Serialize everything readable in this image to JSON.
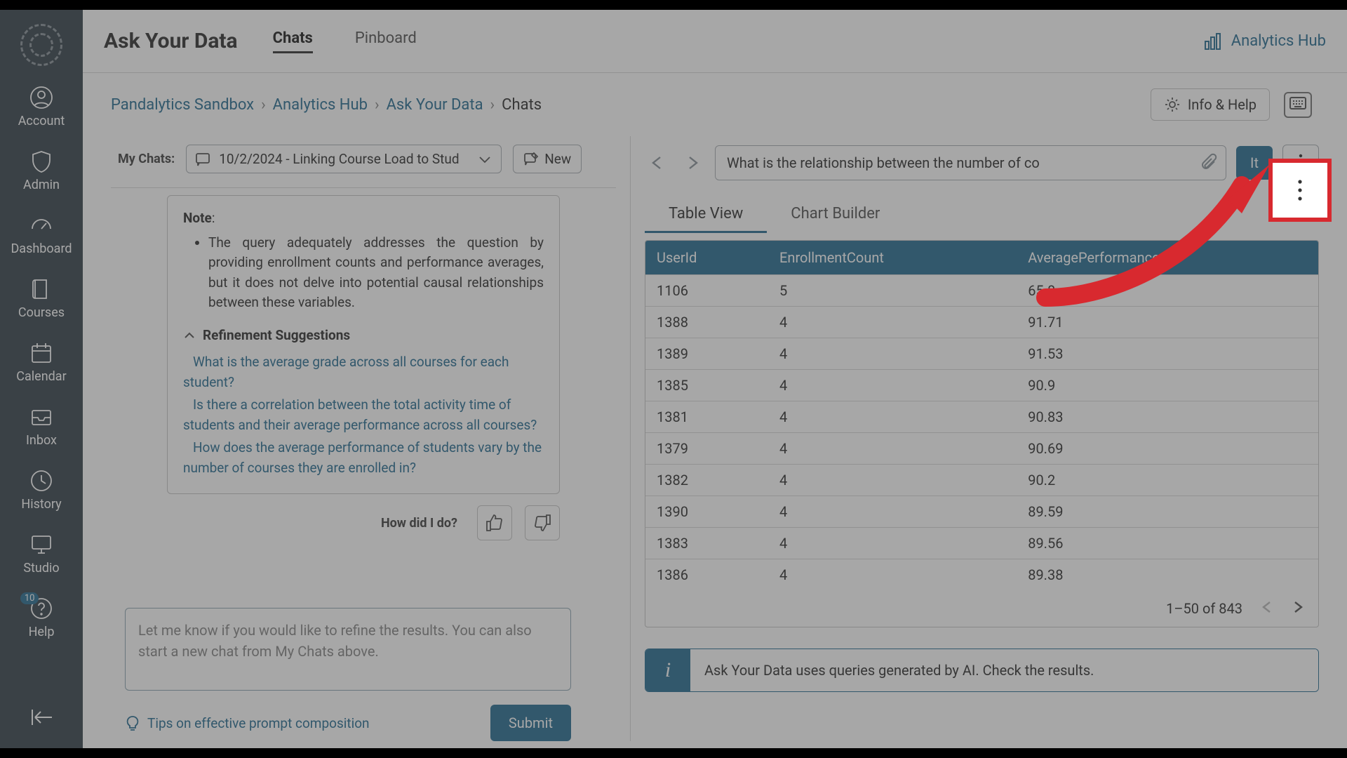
{
  "sidebar": {
    "items": [
      {
        "label": "Account"
      },
      {
        "label": "Admin"
      },
      {
        "label": "Dashboard"
      },
      {
        "label": "Courses"
      },
      {
        "label": "Calendar"
      },
      {
        "label": "Inbox"
      },
      {
        "label": "History"
      },
      {
        "label": "Studio"
      },
      {
        "label": "Help",
        "badge": "10"
      }
    ]
  },
  "header": {
    "app_title": "Ask Your Data",
    "tabs": [
      {
        "label": "Chats"
      },
      {
        "label": "Pinboard"
      }
    ],
    "hub_link": "Analytics Hub"
  },
  "breadcrumb": {
    "items": [
      "Pandalytics Sandbox",
      "Analytics Hub",
      "Ask Your Data",
      "Chats"
    ],
    "info_help": "Info & Help"
  },
  "left": {
    "mychats_label": "My Chats:",
    "selected_chat": "10/2/2024 - Linking Course Load to Stud",
    "new_btn": "New",
    "note_label": "Note",
    "note_bullet": "The query adequately addresses the question by providing enrollment counts and performance averages, but it does not delve into potential causal relationships between these variables.",
    "refine_header": "Refinement Suggestions",
    "suggestions": [
      "What is the average grade across all courses for each student?",
      "Is there a correlation between the total activity time of students and their average performance across all courses?",
      "How does the average performance of students vary by the number of courses they are enrolled in?"
    ],
    "feedback_q": "How did I do?",
    "refine_placeholder": "Let me know if you would like to refine the results.  You can also start a new chat from My Chats above.",
    "tips": "Tips on effective prompt composition",
    "submit": "Submit"
  },
  "right": {
    "query": "What is the relationship between the number of co",
    "askit": "It",
    "view_tabs": [
      {
        "label": "Table View"
      },
      {
        "label": "Chart Builder"
      }
    ],
    "columns": [
      "UserId",
      "EnrollmentCount",
      "AveragePerformance"
    ],
    "rows": [
      [
        "1106",
        "5",
        "65.8"
      ],
      [
        "1388",
        "4",
        "91.71"
      ],
      [
        "1389",
        "4",
        "91.53"
      ],
      [
        "1385",
        "4",
        "90.9"
      ],
      [
        "1381",
        "4",
        "90.83"
      ],
      [
        "1379",
        "4",
        "90.69"
      ],
      [
        "1382",
        "4",
        "90.2"
      ],
      [
        "1390",
        "4",
        "89.59"
      ],
      [
        "1383",
        "4",
        "89.56"
      ],
      [
        "1386",
        "4",
        "89.38"
      ]
    ],
    "pager": "1–50 of 843",
    "banner": "Ask Your Data uses queries generated by AI. Check the results."
  }
}
